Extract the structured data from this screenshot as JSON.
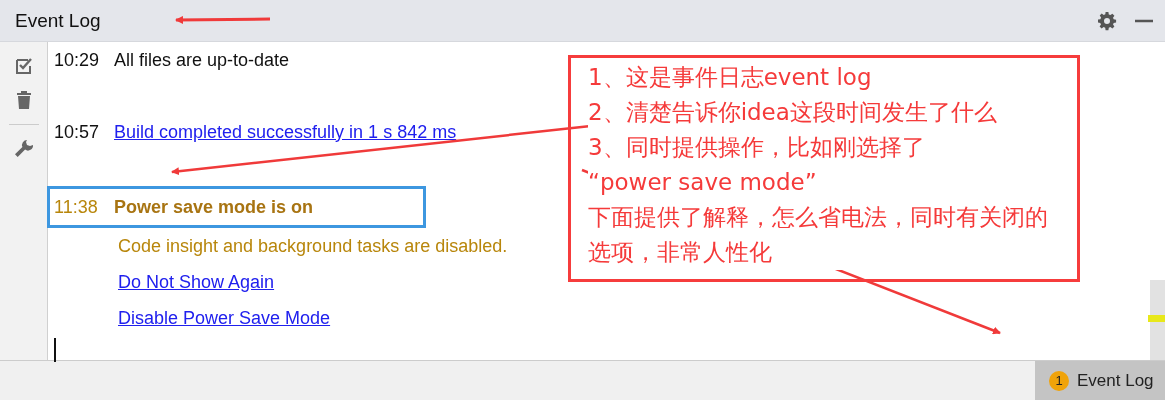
{
  "header": {
    "title": "Event Log"
  },
  "entries": [
    {
      "time": "10:29",
      "kind": "plain",
      "text": "All files are up-to-date",
      "highlighted": false
    },
    {
      "time": "10:57",
      "kind": "link",
      "text": "Build completed successfully in 1 s 842 ms",
      "highlighted": false
    },
    {
      "time": "11:38",
      "kind": "warning",
      "text": "Power save mode is on",
      "detail": "Code insight and background tasks are disabled.",
      "links": [
        "Do Not Show Again",
        "Disable Power Save Mode"
      ],
      "highlighted": true
    }
  ],
  "callout": {
    "lines": [
      "1、这是事件日志event log",
      "2、清楚告诉你idea这段时间发生了什么",
      "3、同时提供操作，比如刚选择了",
      "“power save mode”",
      "下面提供了解释，怎么省电法，同时有关闭的选项，非常人性化"
    ]
  },
  "status_bar": {
    "button": {
      "label": "Event Log",
      "badge": "1"
    }
  }
}
